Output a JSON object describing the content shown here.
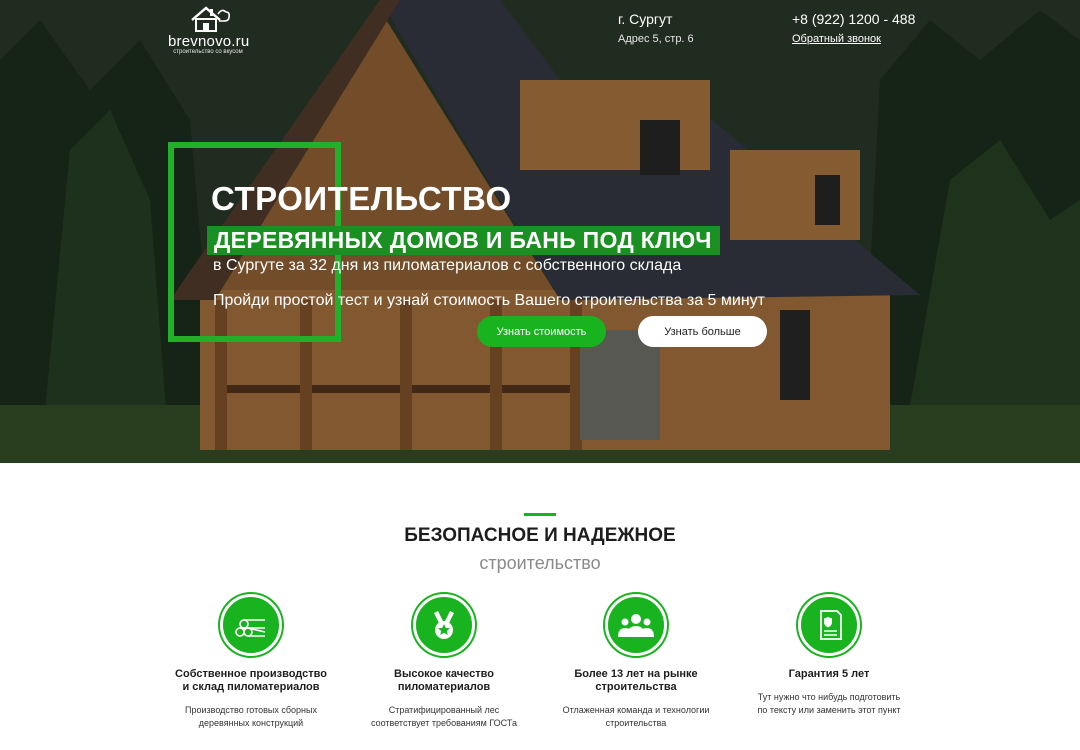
{
  "header": {
    "logo_text": "brevnovo.ru",
    "logo_sub": "строительство со вкусом",
    "city": "г. Сургут",
    "address": "Адрес 5, стр. 6",
    "phone": "+8 (922) 1200 - 488",
    "callback": "Обратный звонок"
  },
  "hero": {
    "title_line1": "СТРОИТЕЛЬСТВО",
    "title_line2": "ДЕРЕВЯННЫХ ДОМОВ И БАНЬ ПОД КЛЮЧ",
    "subtitle": "в Сургуте за 32 дня из пиломатериалов с собственного склада",
    "pitch": "Пройди простой тест и узнай стоимость Вашего строительства за 5 минут",
    "cta_primary": "Узнать стоимость",
    "cta_secondary": "Узнать больше"
  },
  "section": {
    "title": "БЕЗОПАСНОЕ И НАДЕЖНОЕ",
    "subtitle": "строительство"
  },
  "features": [
    {
      "icon": "logs-icon",
      "title1": "Собственное производство",
      "title2": "и склад пиломатериалов",
      "text1": "Производство готовых сборных",
      "text2": "деревянных конструкций"
    },
    {
      "icon": "medal-icon",
      "title1": "Высокое качество",
      "title2": "пиломатериалов",
      "text1": "Стратифицированный лес",
      "text2": "соответствует требованиям ГОСТа"
    },
    {
      "icon": "team-icon",
      "title1": "Более 13 лет на рынке",
      "title2": "строительства",
      "text1": "Отлаженная команда и технологии",
      "text2": "строительства"
    },
    {
      "icon": "certificate-icon",
      "title1": "Гарантия 5 лет",
      "title2": "",
      "text1": "Тут нужно что нибудь подготовить",
      "text2": "по тексту или заменить этот пункт"
    }
  ],
  "colors": {
    "accent": "#18b31f",
    "accent_dark": "#1a8f22"
  }
}
